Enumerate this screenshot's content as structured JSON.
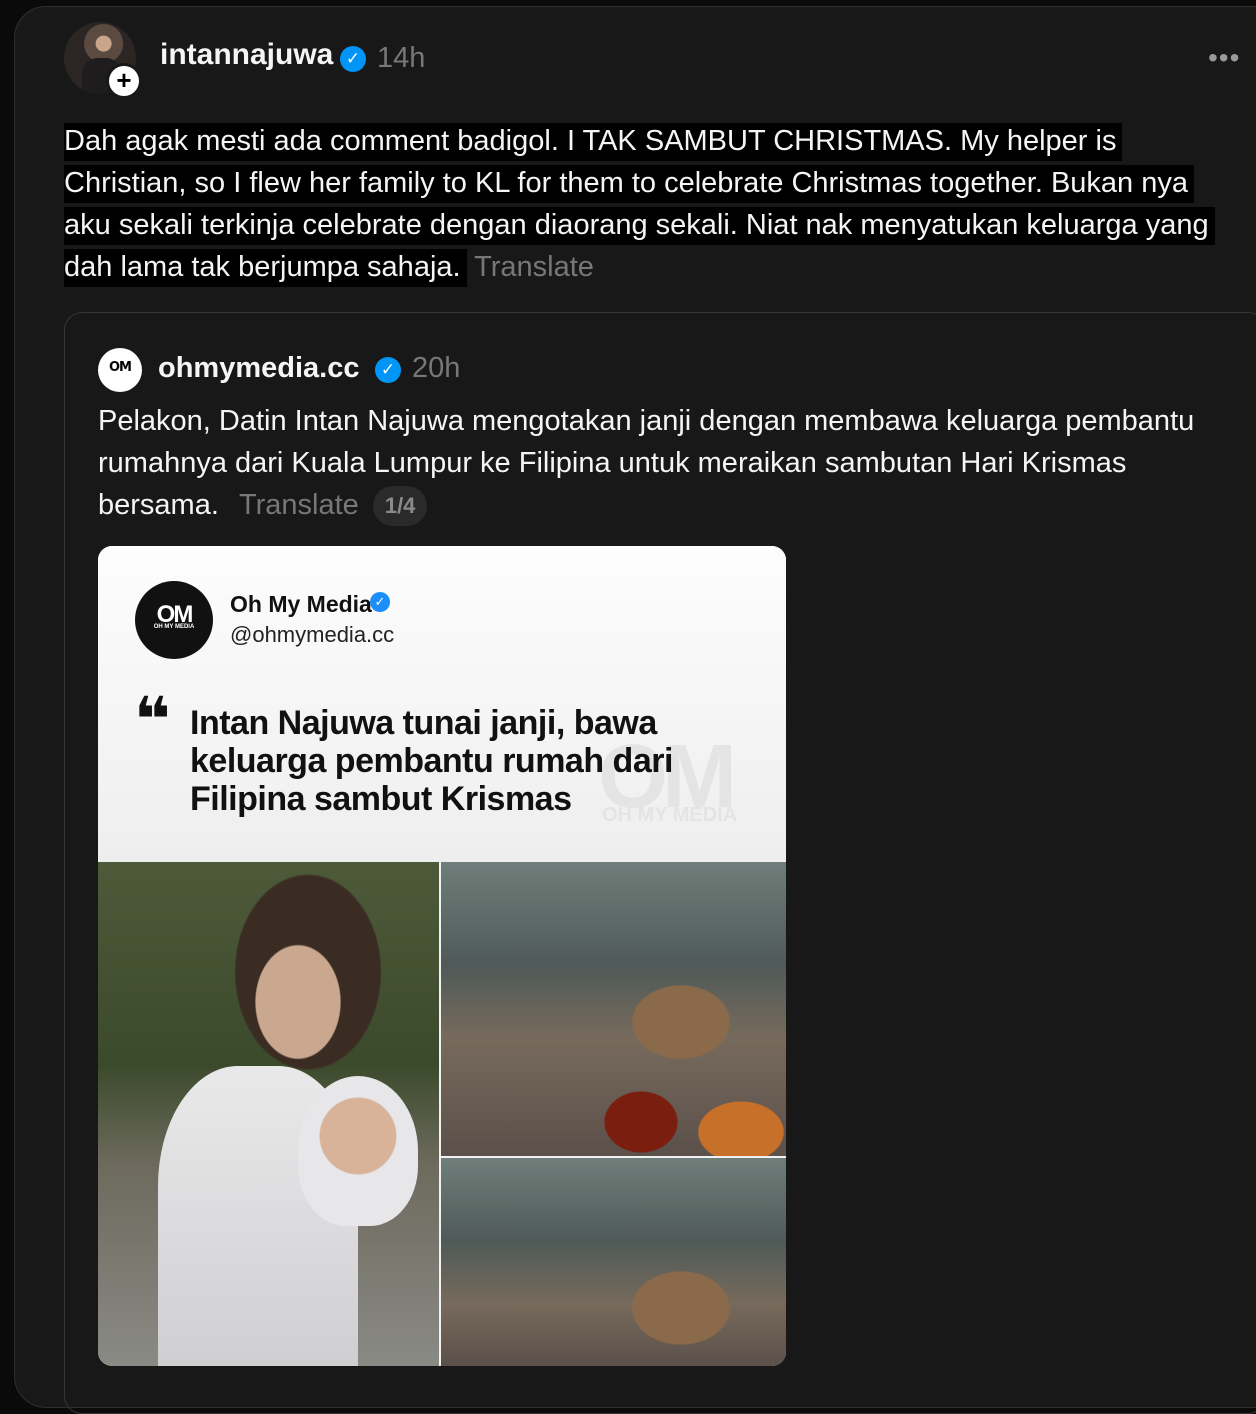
{
  "post": {
    "username": "intannajuwa",
    "time": "14h",
    "more_label": "•••",
    "follow_label": "+",
    "caption": "Dah agak mesti ada comment badigol. I TAK SAMBUT CHRISTMAS. My helper is Christian, so I flew her family to KL for them to celebrate Christmas together. Bukan nya aku sekali terkinja celebrate dengan diaorang sekali. Niat nak menyatukan keluarga yang dah lama tak berjumpa sahaja.",
    "translate_label": "Translate"
  },
  "quoted_post": {
    "avatar_text": "OM",
    "username": "ohmymedia.cc",
    "time": "20h",
    "text": "Pelakon, Datin Intan Najuwa mengotakan janji dengan membawa keluarga pembantu rumahnya dari Kuala Lumpur ke Filipina untuk meraikan sambutan Hari Krismas bersama.",
    "translate_label": "Translate",
    "pager": "1/4"
  },
  "media_card": {
    "logo_text": "OM",
    "logo_sub": "OH MY MEDIA",
    "account_name": "Oh My Media",
    "account_handle": "@ohmymedia.cc",
    "quote_mark": "❝",
    "headline": "Intan Najuwa tunai janji, bawa keluarga pembantu rumah dari Filipina sambut Krismas",
    "watermark": "OM",
    "watermark_sub": "OH MY MEDIA"
  },
  "icons": {
    "verified": "verified-badge-icon",
    "more": "more-options-icon"
  },
  "colors": {
    "background": "#181818",
    "verified": "#0095f6",
    "muted_text": "#777777"
  }
}
